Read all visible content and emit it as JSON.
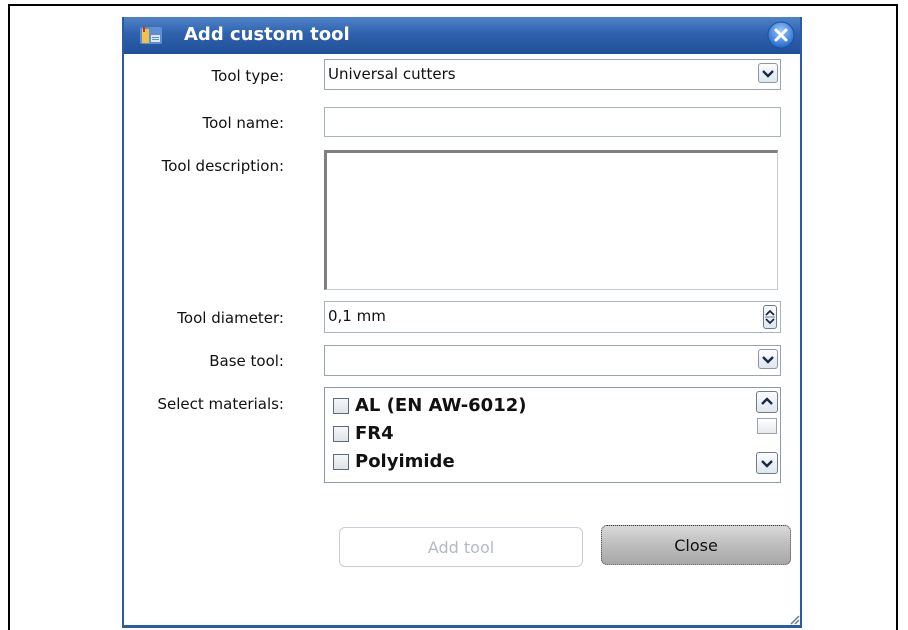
{
  "dialog": {
    "title": "Add custom tool",
    "icons": {
      "title": "tool-library-icon",
      "close": "close-icon"
    }
  },
  "form": {
    "tool_type": {
      "label": "Tool type:",
      "value": "Universal cutters"
    },
    "tool_name": {
      "label": "Tool name:",
      "value": ""
    },
    "tool_description": {
      "label": "Tool description:",
      "value": ""
    },
    "tool_diameter": {
      "label": "Tool diameter:",
      "value": "0,1 mm"
    },
    "base_tool": {
      "label": "Base tool:",
      "value": ""
    },
    "materials": {
      "label": "Select materials:",
      "items": [
        {
          "label": "AL (EN AW-6012)",
          "checked": false
        },
        {
          "label": "FR4",
          "checked": false
        },
        {
          "label": "Polyimide",
          "checked": false
        }
      ]
    }
  },
  "buttons": {
    "add_tool": {
      "label": "Add tool",
      "enabled": false
    },
    "close": {
      "label": "Close"
    }
  },
  "colors": {
    "titlebar": "#2f62ad",
    "dialog_border": "#2b5aa6"
  }
}
